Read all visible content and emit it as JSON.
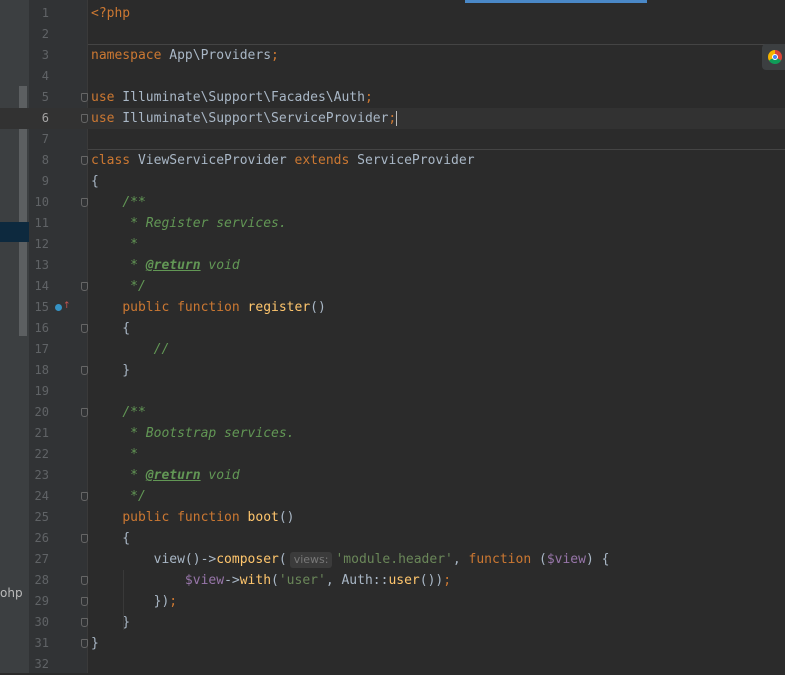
{
  "editor": {
    "current_line": 6,
    "lines": [
      [
        {
          "t": "<?php",
          "c": "k"
        }
      ],
      [],
      [
        {
          "t": "namespace",
          "c": "k"
        },
        {
          "t": " App\\Providers"
        },
        {
          "t": ";",
          "c": "k"
        }
      ],
      [],
      [
        {
          "t": "use",
          "c": "k"
        },
        {
          "t": " Illuminate\\Support\\Facades\\Auth"
        },
        {
          "t": ";",
          "c": "k"
        }
      ],
      [
        {
          "t": "use",
          "c": "k"
        },
        {
          "t": " Illuminate\\Support\\ServiceProvider"
        },
        {
          "t": ";",
          "c": "k"
        }
      ],
      [],
      [
        {
          "t": "class",
          "c": "k"
        },
        {
          "t": " ViewServiceProvider "
        },
        {
          "t": "extends",
          "c": "k"
        },
        {
          "t": " ServiceProvider"
        }
      ],
      [
        {
          "t": "{"
        }
      ],
      [
        {
          "t": "    "
        },
        {
          "t": "/**",
          "c": "c"
        }
      ],
      [
        {
          "t": "     "
        },
        {
          "t": "* Register services.",
          "c": "c"
        }
      ],
      [
        {
          "t": "     "
        },
        {
          "t": "*",
          "c": "c"
        }
      ],
      [
        {
          "t": "     "
        },
        {
          "t": "* ",
          "c": "c"
        },
        {
          "t": "@return",
          "c": "tag"
        },
        {
          "t": " void",
          "c": "c"
        }
      ],
      [
        {
          "t": "     "
        },
        {
          "t": "*/",
          "c": "c"
        }
      ],
      [
        {
          "t": "    "
        },
        {
          "t": "public function",
          "c": "k"
        },
        {
          "t": " "
        },
        {
          "t": "register",
          "c": "f"
        },
        {
          "t": "()"
        }
      ],
      [
        {
          "t": "    {"
        }
      ],
      [
        {
          "t": "        //",
          "c": "c"
        }
      ],
      [
        {
          "t": "    }"
        }
      ],
      [],
      [
        {
          "t": "    "
        },
        {
          "t": "/**",
          "c": "c"
        }
      ],
      [
        {
          "t": "     "
        },
        {
          "t": "* Bootstrap services.",
          "c": "c"
        }
      ],
      [
        {
          "t": "     "
        },
        {
          "t": "*",
          "c": "c"
        }
      ],
      [
        {
          "t": "     "
        },
        {
          "t": "* ",
          "c": "c"
        },
        {
          "t": "@return",
          "c": "tag"
        },
        {
          "t": " void",
          "c": "c"
        }
      ],
      [
        {
          "t": "     "
        },
        {
          "t": "*/",
          "c": "c"
        }
      ],
      [
        {
          "t": "    "
        },
        {
          "t": "public function",
          "c": "k"
        },
        {
          "t": " "
        },
        {
          "t": "boot",
          "c": "f"
        },
        {
          "t": "()"
        }
      ],
      [
        {
          "t": "    {"
        }
      ],
      [
        {
          "t": "        view()->"
        },
        {
          "t": "composer",
          "c": "f"
        },
        {
          "t": "("
        },
        {
          "t": "views:",
          "c": "hint"
        },
        {
          "t": "'module.header'",
          "c": "s"
        },
        {
          "t": ", "
        },
        {
          "t": "function",
          "c": "k"
        },
        {
          "t": " ("
        },
        {
          "t": "$view",
          "c": "v"
        },
        {
          "t": ") {"
        }
      ],
      [
        {
          "t": "            "
        },
        {
          "t": "$view",
          "c": "v"
        },
        {
          "t": "->"
        },
        {
          "t": "with",
          "c": "f"
        },
        {
          "t": "("
        },
        {
          "t": "'user'",
          "c": "s"
        },
        {
          "t": ", Auth::"
        },
        {
          "t": "user",
          "c": "f"
        },
        {
          "t": "())"
        },
        {
          "t": ";",
          "c": "k"
        }
      ],
      [
        {
          "t": "        })"
        },
        {
          "t": ";",
          "c": "k"
        }
      ],
      [
        {
          "t": "    }"
        }
      ],
      [
        {
          "t": "}"
        }
      ],
      []
    ],
    "fold_lines": [
      5,
      6,
      8,
      10,
      14,
      16,
      18,
      20,
      24,
      26,
      28,
      29,
      30,
      31
    ]
  },
  "left_panel": {
    "fragment_text": "ohp"
  },
  "colors": {
    "keyword": "#cc7832",
    "function": "#ffc66d",
    "string": "#6a8759",
    "comment": "#629755",
    "variable": "#9876aa",
    "text": "#a9b7c6",
    "background": "#2b2b2b"
  },
  "icons": [
    "chrome-icon",
    "implements-method-icon",
    "fold-marker-icon"
  ]
}
